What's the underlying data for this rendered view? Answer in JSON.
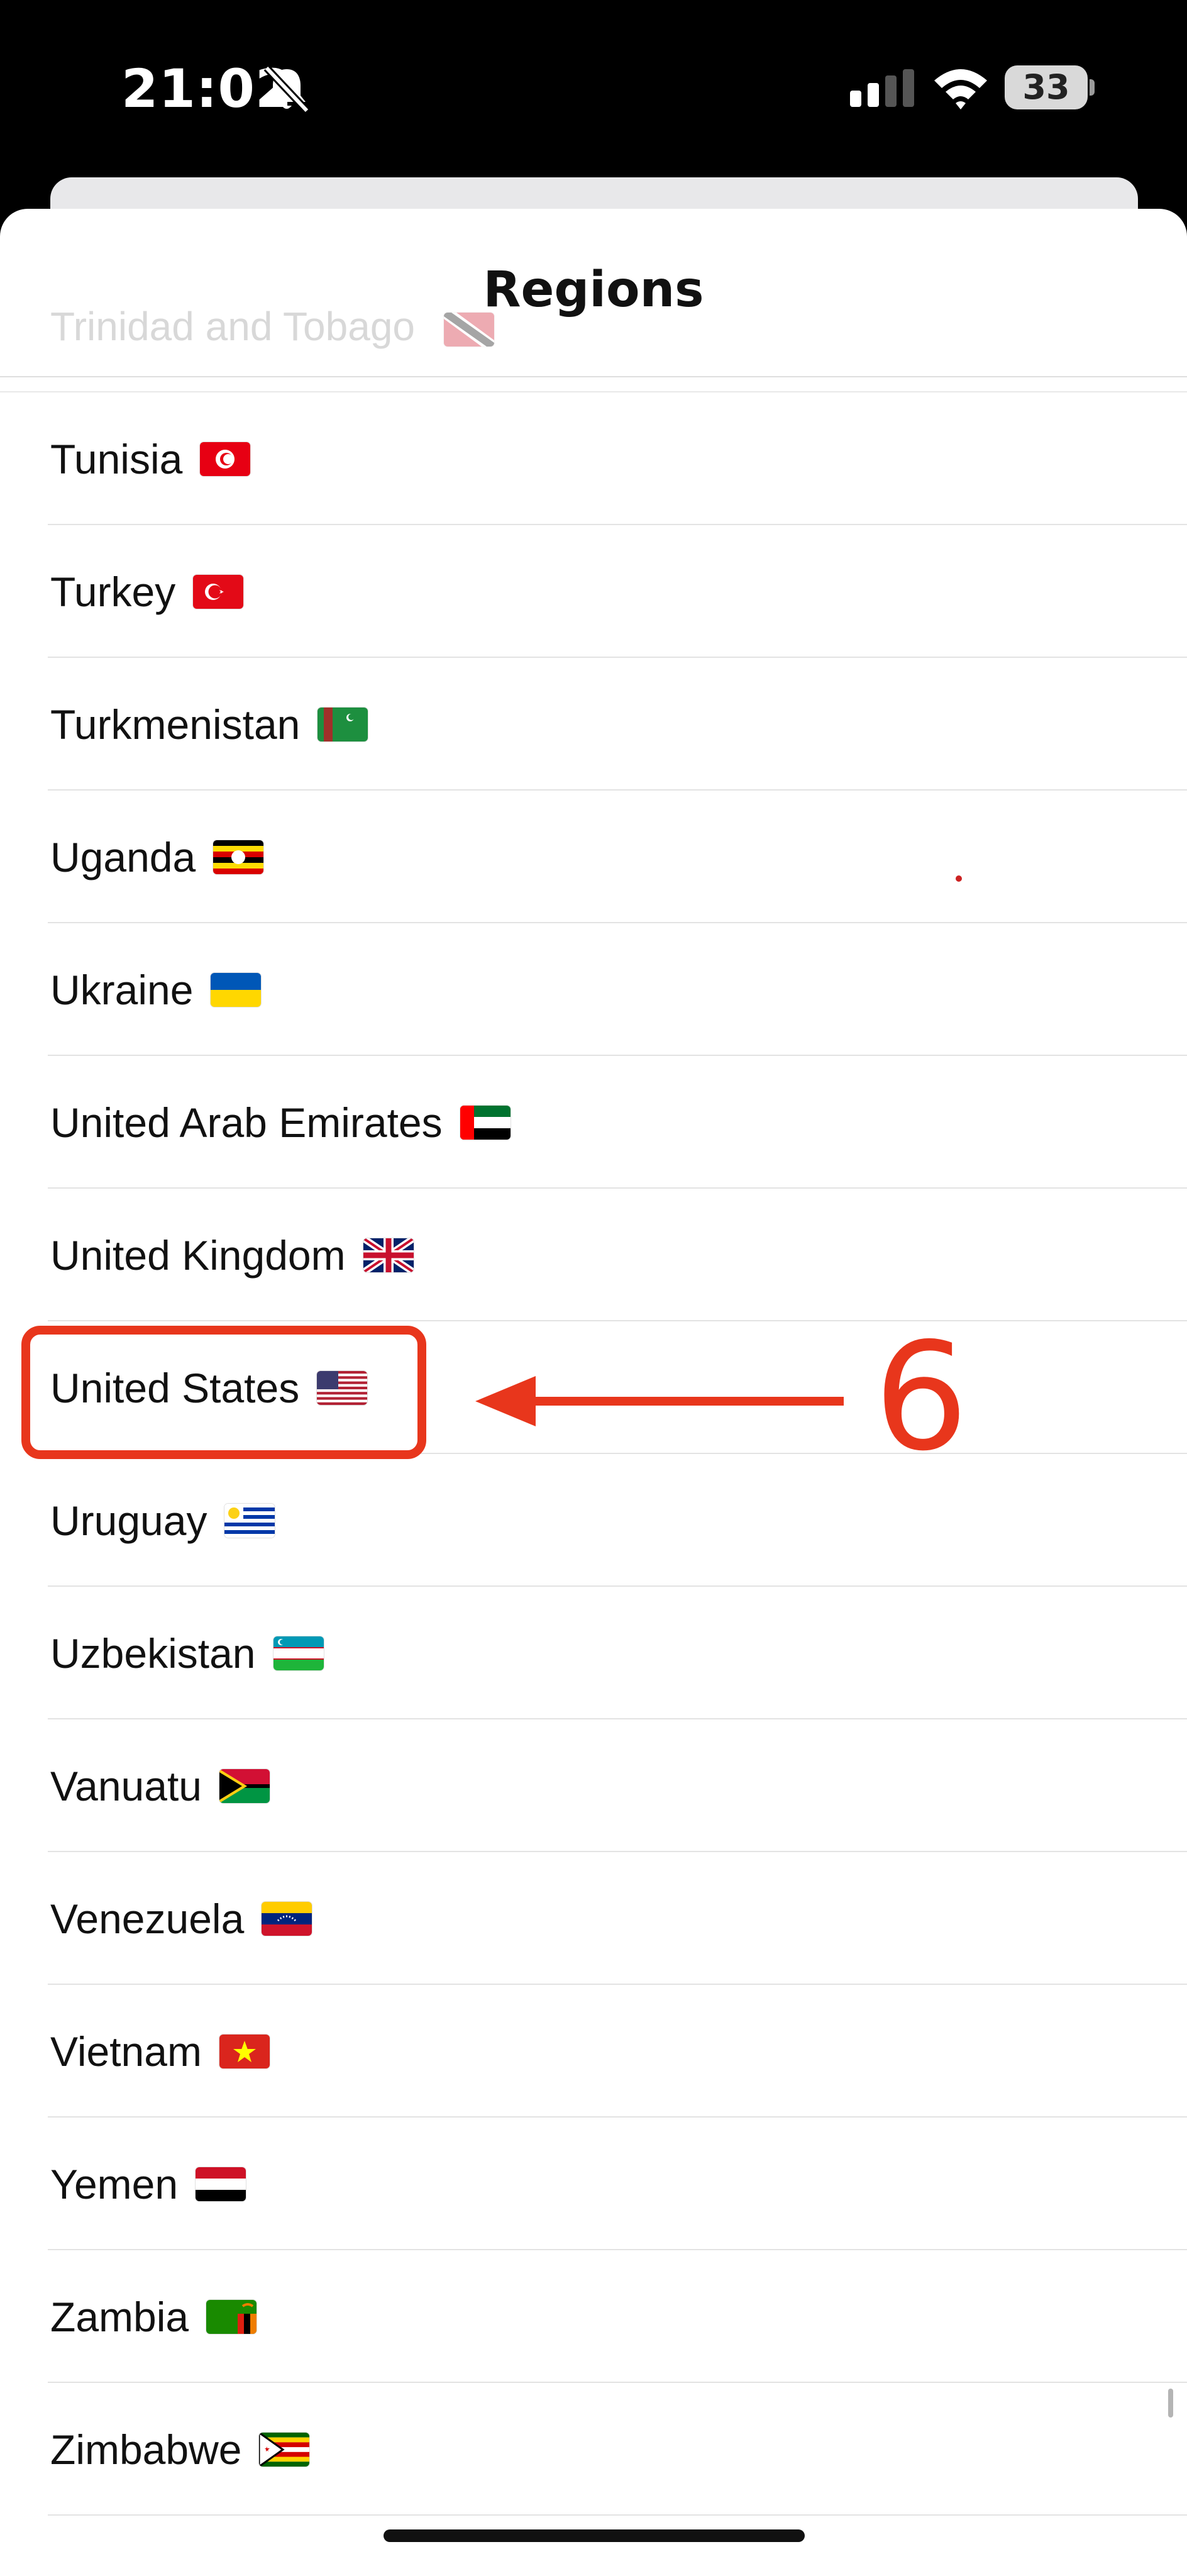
{
  "status_bar": {
    "time": "21:02",
    "battery": "33",
    "icons": [
      "bell-slash-icon",
      "cellular-signal-icon",
      "wifi-icon",
      "battery-icon"
    ]
  },
  "sheet": {
    "title": "Regions",
    "faded_row": {
      "label": "Trinidad and Tobago",
      "flag": "tt"
    }
  },
  "regions": [
    {
      "label": "Tunisia",
      "flag": "tn"
    },
    {
      "label": "Turkey",
      "flag": "tr"
    },
    {
      "label": "Turkmenistan",
      "flag": "tm"
    },
    {
      "label": "Uganda",
      "flag": "ug"
    },
    {
      "label": "Ukraine",
      "flag": "ua"
    },
    {
      "label": "United Arab Emirates",
      "flag": "ae"
    },
    {
      "label": "United Kingdom",
      "flag": "gb"
    },
    {
      "label": "United States",
      "flag": "us"
    },
    {
      "label": "Uruguay",
      "flag": "uy"
    },
    {
      "label": "Uzbekistan",
      "flag": "uz"
    },
    {
      "label": "Vanuatu",
      "flag": "vu"
    },
    {
      "label": "Venezuela",
      "flag": "ve"
    },
    {
      "label": "Vietnam",
      "flag": "vn"
    },
    {
      "label": "Yemen",
      "flag": "ye"
    },
    {
      "label": "Zambia",
      "flag": "zm"
    },
    {
      "label": "Zimbabwe",
      "flag": "zw"
    }
  ],
  "annotation": {
    "step": "6",
    "target": "United States",
    "color": "#e8361c"
  }
}
